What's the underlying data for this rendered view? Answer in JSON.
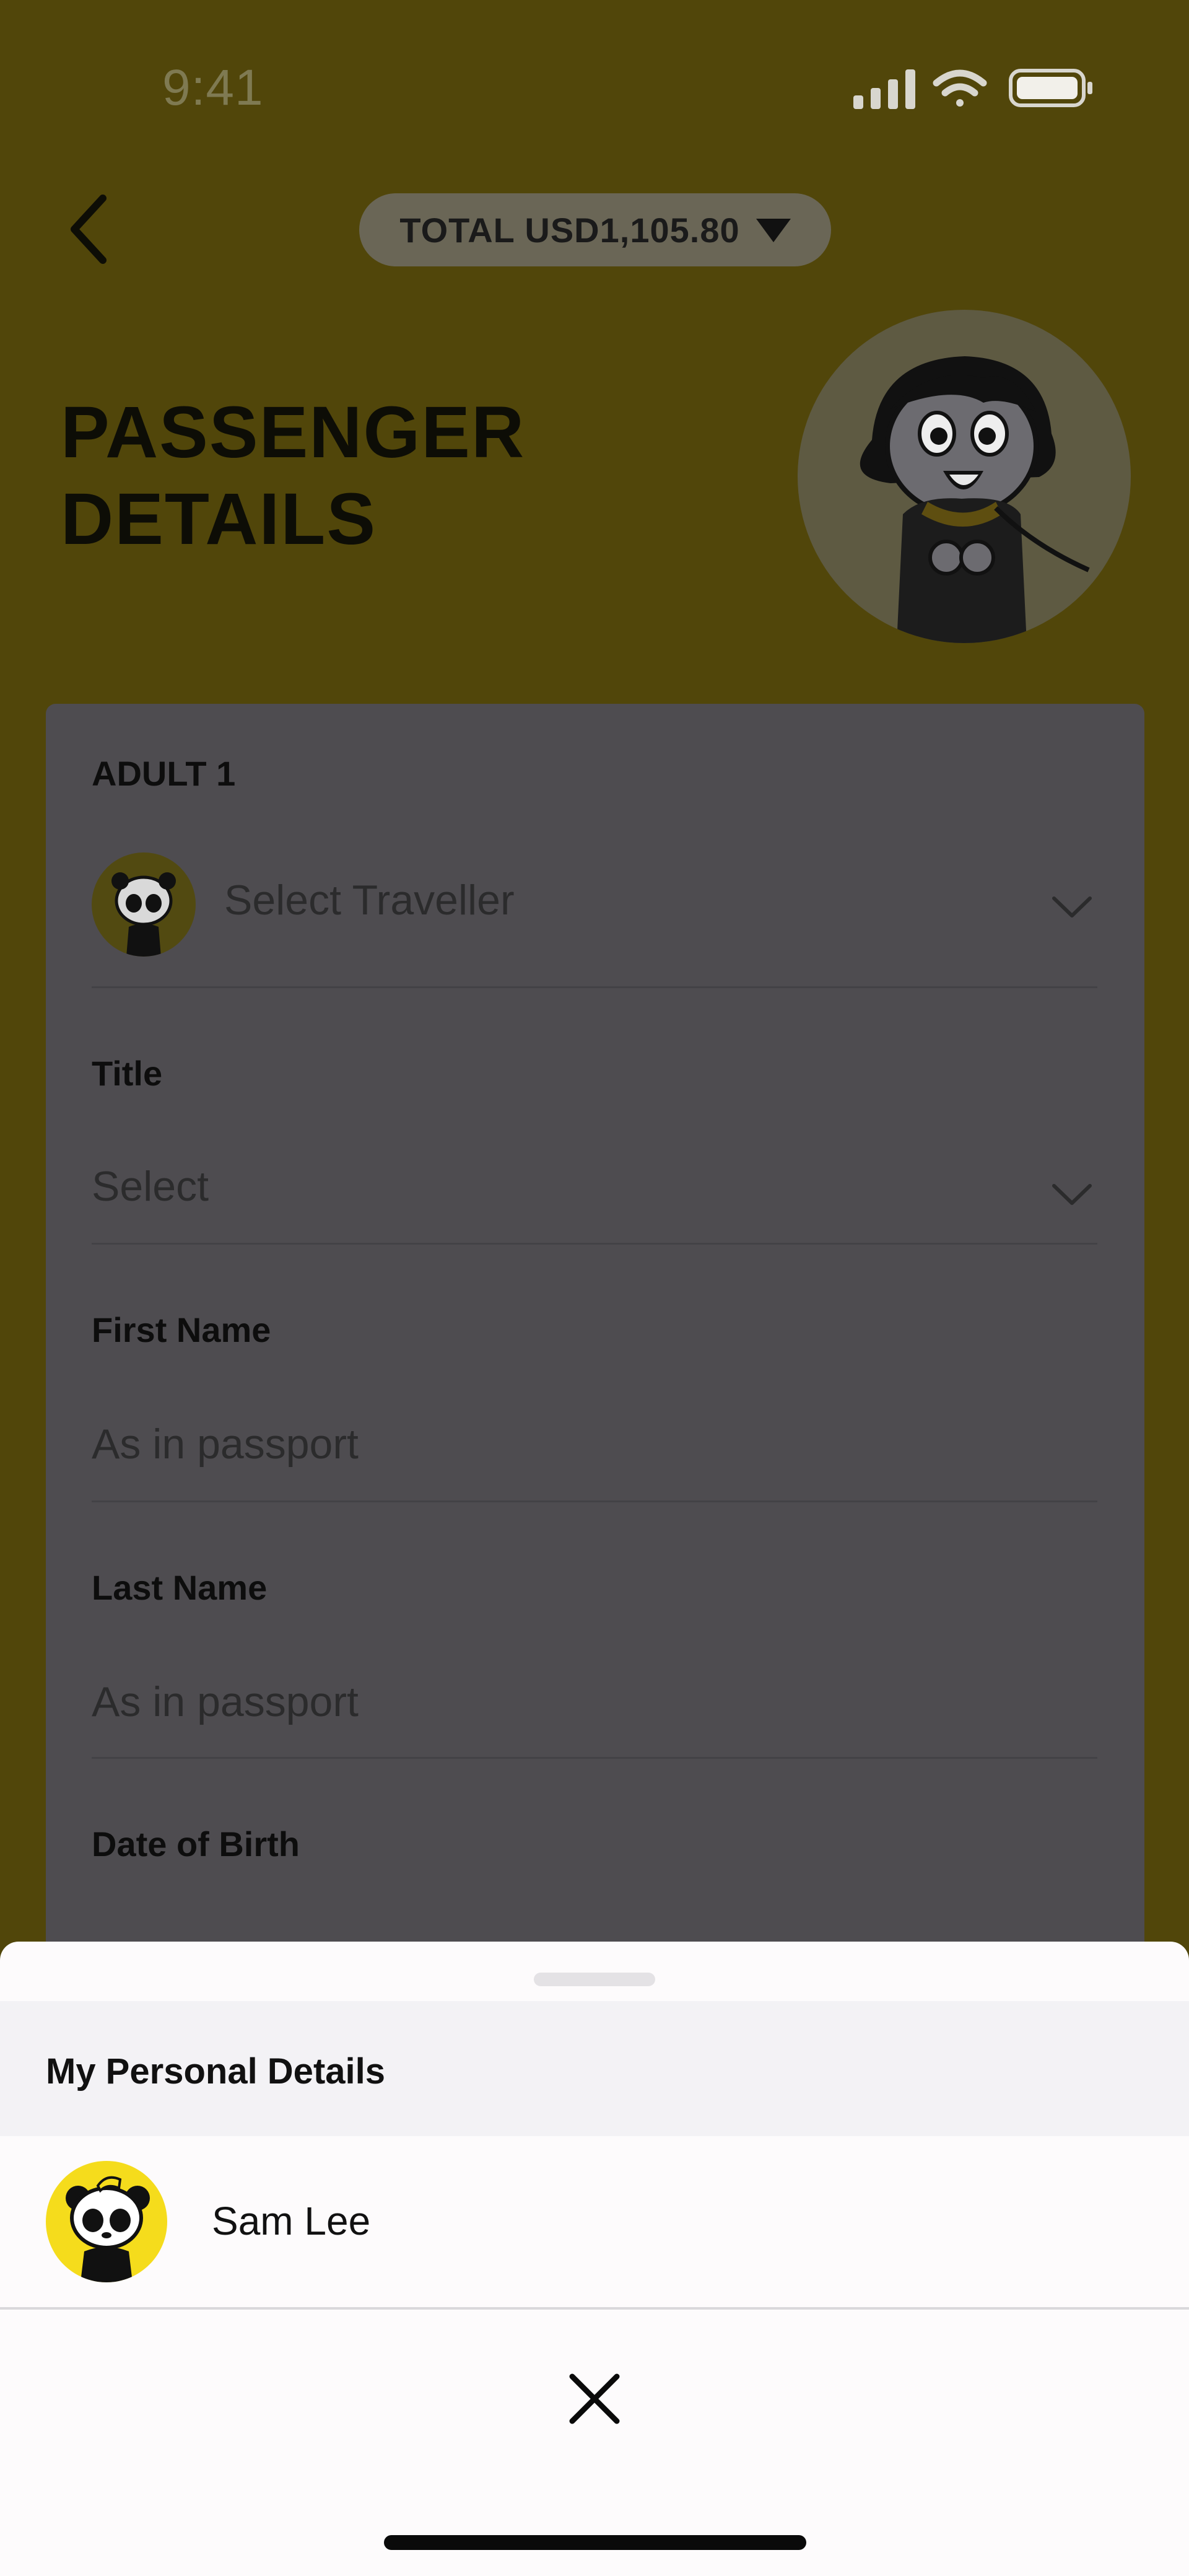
{
  "status": {
    "time": "9:41"
  },
  "header": {
    "total": "TOTAL USD1,105.80",
    "title_line1": "PASSENGER",
    "title_line2": "DETAILS"
  },
  "form": {
    "section": "ADULT 1",
    "traveller_placeholder": "Select Traveller",
    "title_label": "Title",
    "title_placeholder": "Select",
    "first_name_label": "First Name",
    "first_name_placeholder": "As in passport",
    "last_name_label": "Last Name",
    "last_name_placeholder": "As in passport",
    "dob_label": "Date of Birth"
  },
  "sheet": {
    "section_title": "My Personal Details",
    "travellers": [
      {
        "name": "Sam Lee"
      }
    ]
  },
  "icons": [
    "cellular-signal-icon",
    "wifi-icon",
    "battery-icon",
    "back-chevron-icon",
    "caret-down-icon",
    "chevron-down-icon",
    "close-icon"
  ],
  "colors": {
    "brand_yellow": "#f5dc1c",
    "overlay_dim": "#51460a"
  }
}
